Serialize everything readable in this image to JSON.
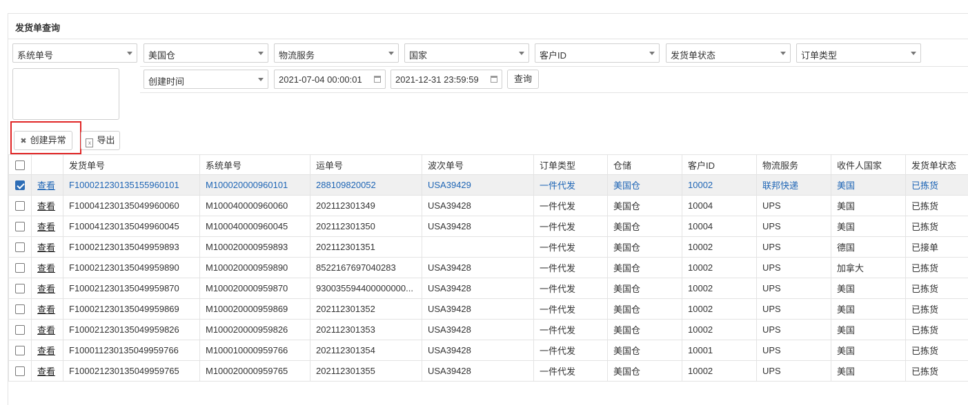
{
  "panel": {
    "title": "发货单查询"
  },
  "filters": {
    "row1": [
      {
        "name": "system-order-select",
        "value": "系统单号"
      },
      {
        "name": "warehouse-select",
        "value": "美国仓"
      },
      {
        "name": "logistics-service-select",
        "value": "物流服务"
      },
      {
        "name": "country-select",
        "value": "国家"
      },
      {
        "name": "customer-id-select",
        "value": "客户ID"
      },
      {
        "name": "shipment-status-select",
        "value": "发货单状态"
      },
      {
        "name": "order-type-select",
        "value": "订单类型"
      }
    ],
    "time_type": "创建时间",
    "start_date": "2021-07-04 00:00:01",
    "end_date": "2021-12-31 23:59:59",
    "query_label": "查询"
  },
  "toolbar": {
    "create_exception_label": "创建异常",
    "export_label": "导出"
  },
  "table": {
    "columns": [
      "发货单号",
      "系统单号",
      "运单号",
      "波次单号",
      "订单类型",
      "仓储",
      "客户ID",
      "物流服务",
      "收件人国家",
      "发货单状态"
    ],
    "view_label": "查看",
    "rows": [
      {
        "checked": true,
        "shipment": "F100021230135155960101",
        "system": "M100020000960101",
        "waybill": "288109820052",
        "wave": "USA39429",
        "type": "一件代发",
        "warehouse": "美国仓",
        "customer": "10002",
        "logistics": "联邦快递",
        "country": "美国",
        "status": "已拣货"
      },
      {
        "checked": false,
        "shipment": "F100041230135049960060",
        "system": "M100040000960060",
        "waybill": "202112301349",
        "wave": "USA39428",
        "type": "一件代发",
        "warehouse": "美国仓",
        "customer": "10004",
        "logistics": "UPS",
        "country": "美国",
        "status": "已拣货"
      },
      {
        "checked": false,
        "shipment": "F100041230135049960045",
        "system": "M100040000960045",
        "waybill": "202112301350",
        "wave": "USA39428",
        "type": "一件代发",
        "warehouse": "美国仓",
        "customer": "10004",
        "logistics": "UPS",
        "country": "美国",
        "status": "已拣货"
      },
      {
        "checked": false,
        "shipment": "F100021230135049959893",
        "system": "M100020000959893",
        "waybill": "202112301351",
        "wave": "",
        "type": "一件代发",
        "warehouse": "美国仓",
        "customer": "10002",
        "logistics": "UPS",
        "country": "德国",
        "status": "已接单"
      },
      {
        "checked": false,
        "shipment": "F100021230135049959890",
        "system": "M100020000959890",
        "waybill": "8522167697040283",
        "wave": "USA39428",
        "type": "一件代发",
        "warehouse": "美国仓",
        "customer": "10002",
        "logistics": "UPS",
        "country": "加拿大",
        "status": "已拣货"
      },
      {
        "checked": false,
        "shipment": "F100021230135049959870",
        "system": "M100020000959870",
        "waybill": "930035594400000000...",
        "wave": "USA39428",
        "type": "一件代发",
        "warehouse": "美国仓",
        "customer": "10002",
        "logistics": "UPS",
        "country": "美国",
        "status": "已拣货"
      },
      {
        "checked": false,
        "shipment": "F100021230135049959869",
        "system": "M100020000959869",
        "waybill": "202112301352",
        "wave": "USA39428",
        "type": "一件代发",
        "warehouse": "美国仓",
        "customer": "10002",
        "logistics": "UPS",
        "country": "美国",
        "status": "已拣货"
      },
      {
        "checked": false,
        "shipment": "F100021230135049959826",
        "system": "M100020000959826",
        "waybill": "202112301353",
        "wave": "USA39428",
        "type": "一件代发",
        "warehouse": "美国仓",
        "customer": "10002",
        "logistics": "UPS",
        "country": "美国",
        "status": "已拣货"
      },
      {
        "checked": false,
        "shipment": "F100011230135049959766",
        "system": "M100010000959766",
        "waybill": "202112301354",
        "wave": "USA39428",
        "type": "一件代发",
        "warehouse": "美国仓",
        "customer": "10001",
        "logistics": "UPS",
        "country": "美国",
        "status": "已拣货"
      },
      {
        "checked": false,
        "shipment": "F100021230135049959765",
        "system": "M100020000959765",
        "waybill": "202112301355",
        "wave": "USA39428",
        "type": "一件代发",
        "warehouse": "美国仓",
        "customer": "10002",
        "logistics": "UPS",
        "country": "美国",
        "status": "已拣货"
      }
    ]
  }
}
